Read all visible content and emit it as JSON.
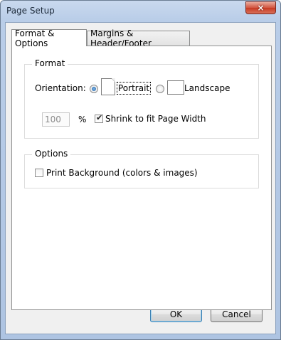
{
  "window": {
    "title": "Page Setup",
    "close_glyph": "×"
  },
  "tabs": [
    {
      "label": "Format & Options",
      "active": true
    },
    {
      "label": "Margins & Header/Footer",
      "active": false
    }
  ],
  "format_group": {
    "label": "Format",
    "orientation_label": "Orientation:",
    "portrait": {
      "label": "Portrait",
      "selected": true
    },
    "landscape": {
      "label": "Landscape",
      "selected": false
    },
    "scale_value": "100",
    "percent_label": "%",
    "shrink_checkbox": {
      "label": "Shrink to fit Page Width",
      "checked": true
    }
  },
  "options_group": {
    "label": "Options",
    "print_background": {
      "label": "Print Background (colors & images)",
      "checked": false
    }
  },
  "buttons": {
    "ok": "OK",
    "cancel": "Cancel"
  },
  "colors": {
    "accent": "#1e5fa3",
    "close_button": "#c63a22",
    "frame": "#b9cde8"
  }
}
